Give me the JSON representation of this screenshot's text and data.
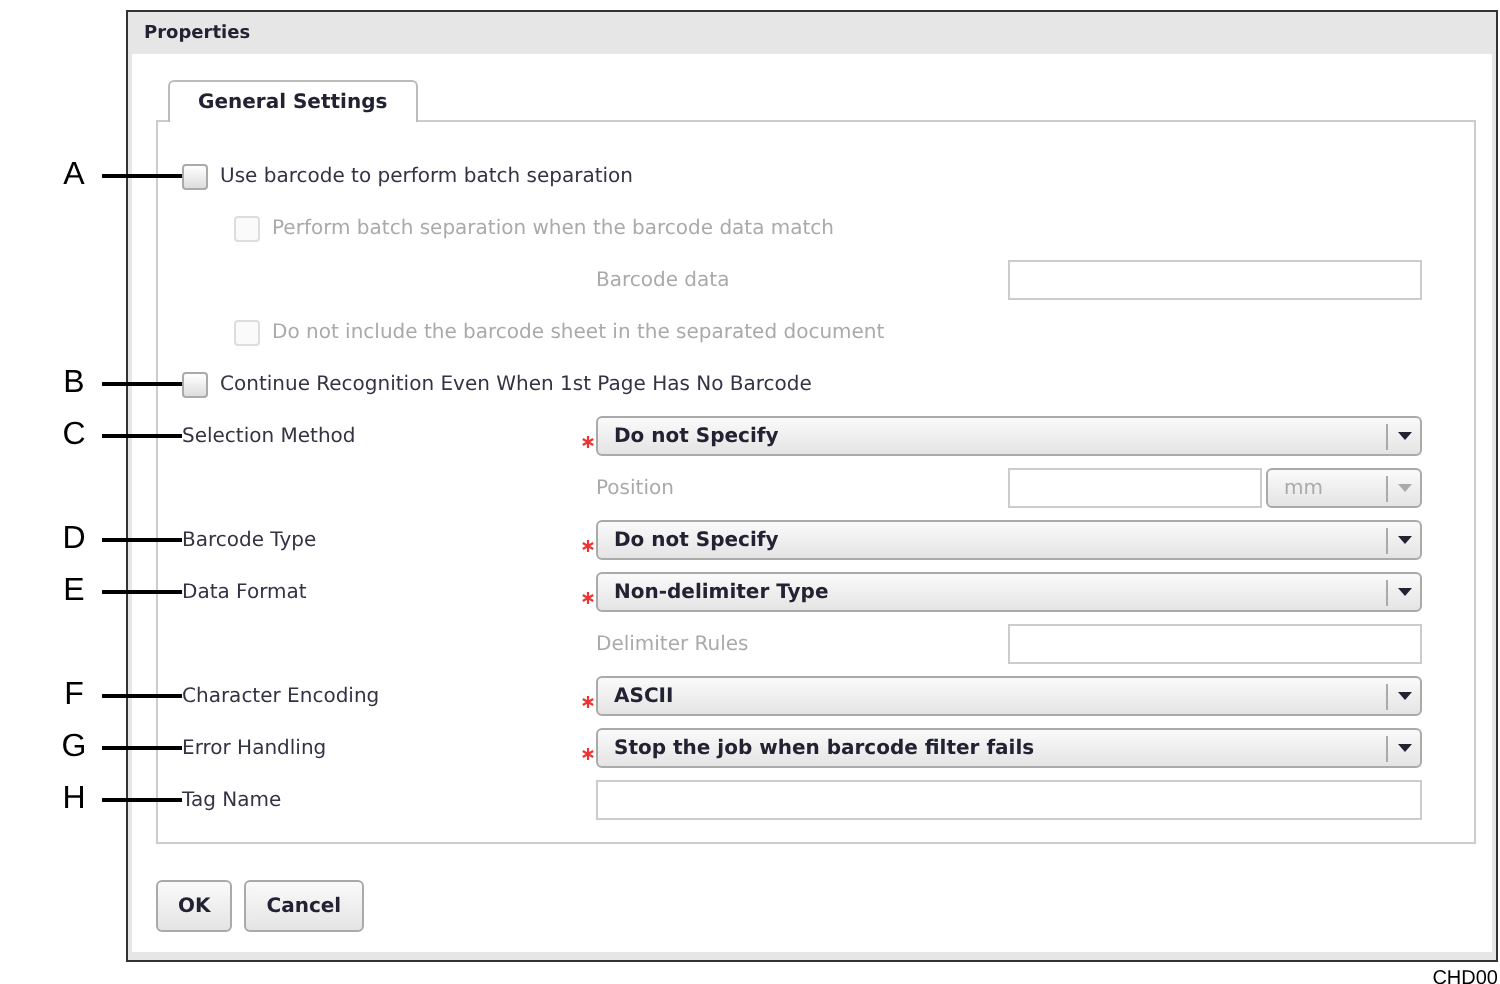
{
  "window": {
    "title": "Properties"
  },
  "tabs": [
    {
      "label": "General Settings",
      "selected": true
    }
  ],
  "rows": [
    {
      "kind": "checkbox",
      "callout": "A",
      "label": "Use barcode to perform batch separation",
      "checked": false,
      "disabled": false,
      "children": [
        {
          "kind": "checkbox",
          "label": "Perform batch separation when the barcode data match",
          "checked": false,
          "disabled": true
        },
        {
          "kind": "field",
          "label": "Barcode data",
          "disabled": true
        },
        {
          "kind": "checkbox",
          "label": "Do not include the barcode sheet in the separated document",
          "checked": false,
          "disabled": true
        }
      ]
    },
    {
      "kind": "checkbox",
      "callout": "B",
      "label": "Continue Recognition Even When 1st Page Has No Barcode",
      "checked": false,
      "disabled": false
    },
    {
      "kind": "select",
      "callout": "C",
      "label": "Selection Method",
      "required": true,
      "value": "Do not Specify"
    },
    {
      "kind": "unit_field",
      "label": "Position",
      "unit": "mm",
      "disabled": true
    },
    {
      "kind": "select",
      "callout": "D",
      "label": "Barcode Type",
      "required": true,
      "value": "Do not Specify"
    },
    {
      "kind": "select",
      "callout": "E",
      "label": "Data Format",
      "required": true,
      "value": "Non-delimiter Type"
    },
    {
      "kind": "field",
      "label": "Delimiter Rules",
      "disabled": true
    },
    {
      "kind": "select",
      "callout": "F",
      "label": "Character Encoding",
      "required": true,
      "value": "ASCII"
    },
    {
      "kind": "select",
      "callout": "G",
      "label": "Error Handling",
      "required": true,
      "value": "Stop the job when barcode filter fails"
    },
    {
      "kind": "text",
      "callout": "H",
      "label": "Tag Name"
    }
  ],
  "buttons": [
    "OK",
    "Cancel"
  ],
  "figure_code": "CHD00"
}
